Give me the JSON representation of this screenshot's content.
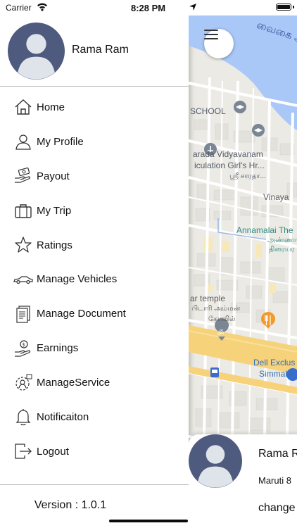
{
  "status_bar": {
    "carrier": "Carrier",
    "time": "8:28 PM"
  },
  "profile": {
    "name": "Rama Ram"
  },
  "menu": [
    {
      "label": "Home",
      "icon": "home-icon"
    },
    {
      "label": "My Profile",
      "icon": "user-icon"
    },
    {
      "label": "Payout",
      "icon": "payout-icon"
    },
    {
      "label": "My Trip",
      "icon": "briefcase-icon"
    },
    {
      "label": "Ratings",
      "icon": "star-icon"
    },
    {
      "label": "Manage Vehicles",
      "icon": "car-icon"
    },
    {
      "label": "Manage Document",
      "icon": "document-icon"
    },
    {
      "label": "Earnings",
      "icon": "earnings-icon"
    },
    {
      "label": "ManageService",
      "icon": "service-icon"
    },
    {
      "label": "Notificaiton",
      "icon": "bell-icon"
    },
    {
      "label": "Logout",
      "icon": "logout-icon"
    }
  ],
  "footer": {
    "version_label": "Version :",
    "version_value": "1.0.1"
  },
  "map": {
    "river_label": "வைகை ஆ",
    "labels": {
      "school": "SCHOOL",
      "sarada_1": "arada Vidyavanam",
      "sarada_2": "iculation Girl's Hr...",
      "sarada_3": "ஸ்ரீ சாரதா...",
      "vinay": "Vinaya",
      "annamalai": "Annamalai The",
      "annamalai_ta_1": "அண்ணா",
      "annamalai_ta_2": "திரையர",
      "temple": "ar temple",
      "temple_ta_1": "பிடாரி அம்மன்",
      "temple_ta_2": "கோவில்",
      "dell": "Dell Exclus",
      "simmakkal": "Simmakk"
    }
  },
  "bottom_card": {
    "name": "Rama R",
    "car": "Maruti 8",
    "action": "change"
  },
  "colors": {
    "avatar_bg": "#4e5a7e",
    "avatar_figure": "#dfe3ea",
    "water": "#a9c7f7",
    "road_major": "#f6d27b",
    "accent_teal": "#2e8b81",
    "accent_blue": "#2f6fbd"
  }
}
